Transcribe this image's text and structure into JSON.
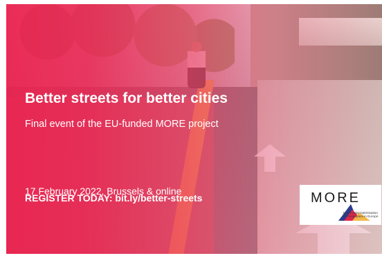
{
  "event": {
    "title": "Better streets for better cities",
    "subtitle": "Final event of the EU-funded MORE project",
    "date_location": "17 February 2022, Brussels & online",
    "register": "REGISTER TODAY: bit.ly/better-streets"
  },
  "logo": {
    "wordmark": "MORE",
    "tagline": "Multimodal Optimisation of Roadspace in Europe"
  },
  "colors": {
    "overlay": "#EB2350",
    "text": "#FFFFFF",
    "logo_blue": "#2B3A8F",
    "logo_red": "#E0264B",
    "logo_yellow": "#F2B84B"
  }
}
